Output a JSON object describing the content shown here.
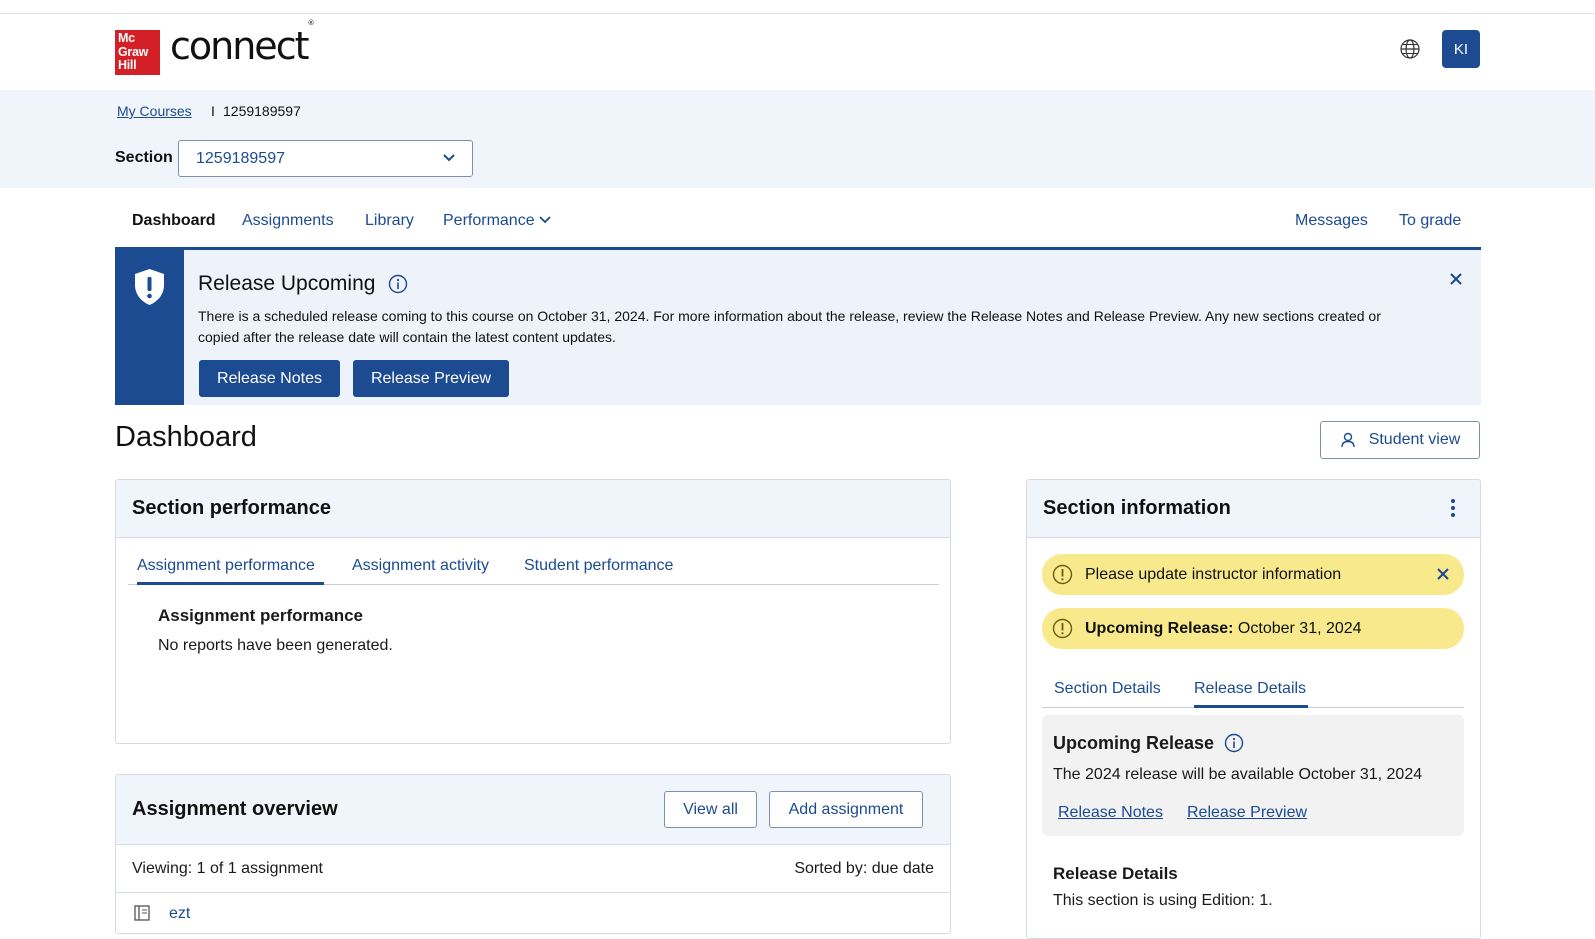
{
  "header": {
    "logo_lines": [
      "Mc",
      "Graw",
      "Hill"
    ],
    "brand": "connect",
    "avatar_initials": "KI"
  },
  "breadcrumb": {
    "link": "My Courses",
    "separator": "I",
    "current": "1259189597"
  },
  "section_select": {
    "label": "Section",
    "value": "1259189597"
  },
  "nav": {
    "items": [
      "Dashboard",
      "Assignments",
      "Library",
      "Performance"
    ],
    "right_items": [
      "Messages",
      "To grade"
    ]
  },
  "banner": {
    "title": "Release Upcoming",
    "text": "There is a scheduled release coming to this course on October 31, 2024. For more information about the release, review the Release Notes and Release Preview. Any new sections created or copied after the release date will contain the latest content updates.",
    "release_notes_button": "Release Notes",
    "release_preview_button": "Release Preview"
  },
  "dashboard": {
    "title": "Dashboard",
    "student_view_button": "Student view"
  },
  "section_performance": {
    "title": "Section performance",
    "tabs": [
      "Assignment performance",
      "Assignment activity",
      "Student performance"
    ],
    "subtitle": "Assignment performance",
    "empty_text": "No reports have been generated."
  },
  "assignment_overview": {
    "title": "Assignment overview",
    "view_all_button": "View all",
    "add_assignment_button": "Add assignment",
    "viewing": "Viewing: 1 of 1 assignment",
    "sorted": "Sorted by: due date",
    "items": [
      "ezt"
    ]
  },
  "section_information": {
    "title": "Section information",
    "alert_instructor": "Please update instructor information",
    "alert_release_bold": "Upcoming Release:",
    "alert_release_date": " October 31, 2024",
    "tabs": [
      "Section Details",
      "Release Details"
    ],
    "upcoming_title": "Upcoming Release",
    "upcoming_text": "The 2024 release will be available October 31, 2024",
    "release_notes_link": "Release Notes",
    "release_preview_link": "Release Preview",
    "release_details_title": "Release Details",
    "release_details_text": "This section is using Edition: 1."
  },
  "colors": {
    "primary": "#1c4b91",
    "brand_red": "#d31f26",
    "alert_yellow": "#f8e98c",
    "band_bg": "#f0f5fc"
  }
}
